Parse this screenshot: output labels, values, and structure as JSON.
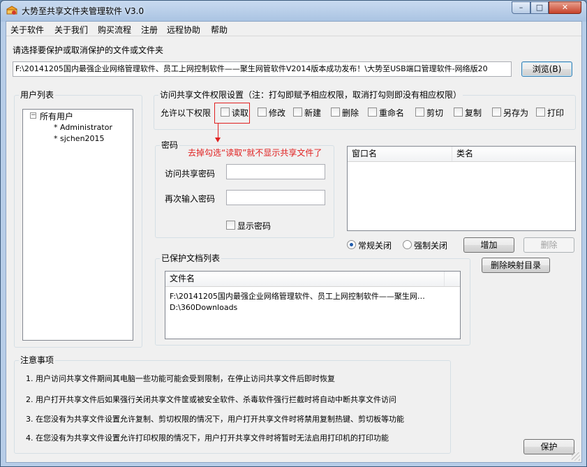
{
  "window": {
    "title": "大势至共享文件夹管理软件 V3.0",
    "min_glyph": "–",
    "max_glyph": "□",
    "close_glyph": "✕"
  },
  "menu": {
    "items": [
      "关于软件",
      "关于我们",
      "购买流程",
      "注册",
      "远程协助",
      "帮助"
    ]
  },
  "select_prompt": "请选择要保护或取消保护的文件或文件夹",
  "path_value": "F:\\20141205国内最强企业网络管理软件、员工上网控制软件——聚生网管软件V2014版本成功发布！\\大势至USB端口管理软件-网络版20",
  "browse_label": "浏览(B)",
  "user_list": {
    "title": "用户列表",
    "root": "所有用户",
    "users": [
      "* Administrator",
      "* sjchen2015"
    ]
  },
  "permissions": {
    "title": "访问共享文件权限设置（注：打勾即赋予相应权限，取消打勾则即没有相应权限）",
    "allow_label": "允许以下权限",
    "items": [
      {
        "label": "读取",
        "checked": false
      },
      {
        "label": "修改",
        "checked": false
      },
      {
        "label": "新建",
        "checked": false
      },
      {
        "label": "删除",
        "checked": false
      },
      {
        "label": "重命名",
        "checked": false
      },
      {
        "label": "剪切",
        "checked": false
      },
      {
        "label": "复制",
        "checked": false
      },
      {
        "label": "另存为",
        "checked": false
      },
      {
        "label": "打印",
        "checked": false
      }
    ]
  },
  "annotation": "去掉勾选“读取”就不显示共享文件了",
  "password": {
    "title": "密码",
    "access_label": "访问共享密码",
    "again_label": "再次输入密码",
    "access_value": "",
    "again_value": "",
    "show_label": "显示密码",
    "show_checked": false
  },
  "window_list": {
    "columns": [
      "窗口名",
      "类名"
    ],
    "rows": []
  },
  "close_mode": {
    "options": [
      {
        "label": "常规关闭",
        "selected": true
      },
      {
        "label": "强制关闭",
        "selected": false
      }
    ]
  },
  "add_label": "增加",
  "delete_label": "删除",
  "delete_map_label": "删除映射目录",
  "protected": {
    "title": "已保护文档列表",
    "column": "文件名",
    "rows": [
      "F:\\20141205国内最强企业网络管理软件、员工上网控制软件——聚生网…",
      "D:\\360Downloads"
    ]
  },
  "notes": {
    "title": "注意事项",
    "lines": [
      "1. 用户访问共享文件期间其电脑一些功能可能会受到限制，在停止访问共享文件后即时恢复",
      "2. 用户打开共享文件后如果强行关闭共享文件筐或被安全软件、杀毒软件强行拦截时将自动中断共享文件访问",
      "3. 在您没有为共享文件设置允许复制、剪切权限的情况下，用户打开共享文件时将禁用复制热键、剪切板等功能",
      "4. 在您没有为共享文件设置允许打印权限的情况下，用户打开共享文件时将暂时无法启用打印机的打印功能"
    ]
  },
  "protect_label": "保护",
  "colors": {
    "annotation_red": "#e02020",
    "accent_blue": "#1f5bab"
  }
}
